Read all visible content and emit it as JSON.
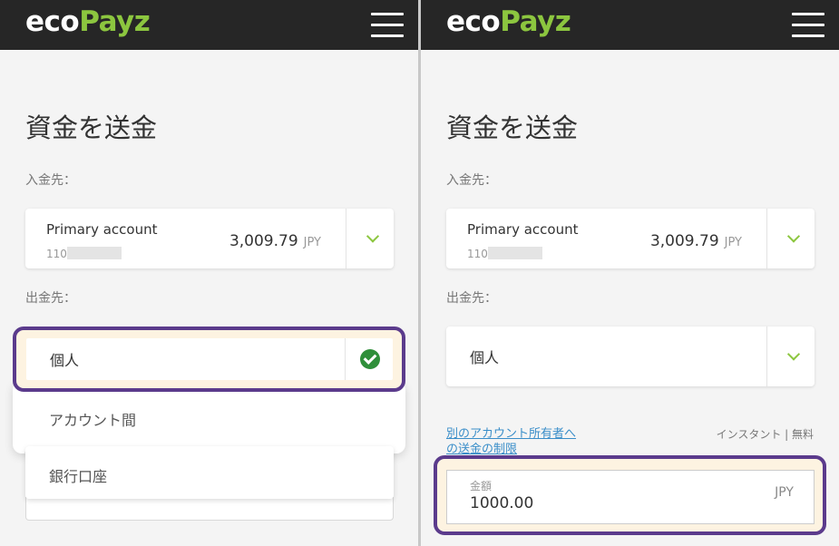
{
  "brand": {
    "logo_eco": "eco",
    "logo_payz": "Payz"
  },
  "colors": {
    "topbar": "#262626",
    "brand_green": "#8cc63f",
    "highlight_border": "#5b3b8c",
    "highlight_fill": "#fdf3e1",
    "link": "#3a8ec9",
    "check_green": "#2f8f3a"
  },
  "page": {
    "title": "資金を送金"
  },
  "deposit": {
    "label": "入金先：",
    "account_name": "Primary account",
    "account_number_prefix": "110",
    "balance": "3,009.79",
    "currency": "JPY"
  },
  "withdraw": {
    "label": "出金先：",
    "selected": "個人",
    "options": [
      "アカウント間",
      "銀行口座"
    ]
  },
  "right_panel": {
    "account_number_prefix": "110",
    "limit_link_line1": "別のアカウント所有者へ",
    "limit_link_line2": "の送金の制限",
    "instant_text": "インスタント | 無料",
    "amount_label": "金額",
    "amount_value": "1000.00",
    "amount_currency": "JPY"
  },
  "icons": {
    "menu": "hamburger-icon",
    "dropdown": "chevron-down-icon",
    "selected": "check-circle-icon"
  }
}
